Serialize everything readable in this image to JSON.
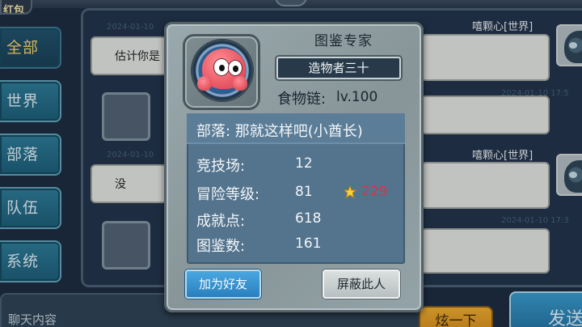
{
  "top": {
    "red_packet_label": "红包"
  },
  "tabs": [
    {
      "label": "全部",
      "selected": true
    },
    {
      "label": "世界"
    },
    {
      "label": "部落"
    },
    {
      "label": "队伍"
    },
    {
      "label": "系统"
    }
  ],
  "messages": [
    {
      "side": "left",
      "timestamp": "2024-01-10",
      "text": "估计你是"
    },
    {
      "side": "right",
      "name": "嘻颗心[世界]",
      "timestamp": "2024-01-10 17:5"
    },
    {
      "side": "left",
      "timestamp": "2024-01-10",
      "text": "没"
    },
    {
      "side": "right",
      "name": "嘻颗心[世界]",
      "timestamp": "2024-01-10 17:3"
    }
  ],
  "input": {
    "placeholder": "聊天内容"
  },
  "buttons": {
    "send_small": "炫一下",
    "send_big": "发送"
  },
  "profile": {
    "title": "图鉴专家",
    "banner": "造物者三十",
    "food_chain_label": "食物链:",
    "food_chain_level": "lv.100",
    "tribe": "部落: 那就这样吧(小酋长)",
    "stats": [
      {
        "label": "竞技场:",
        "value": "12"
      },
      {
        "label": "冒险等级:",
        "value": "81"
      },
      {
        "label": "成就点:",
        "value": "618"
      },
      {
        "label": "图鉴数:",
        "value": "161"
      }
    ],
    "star_value": "229",
    "star_color": "#e0304a",
    "add_friend_label": "加为好友",
    "block_label": "屏蔽此人"
  },
  "colors": {
    "tab_selected_text": "#ffd86a",
    "add_friend_button": "#3a95d0",
    "panel": "#54748e"
  }
}
